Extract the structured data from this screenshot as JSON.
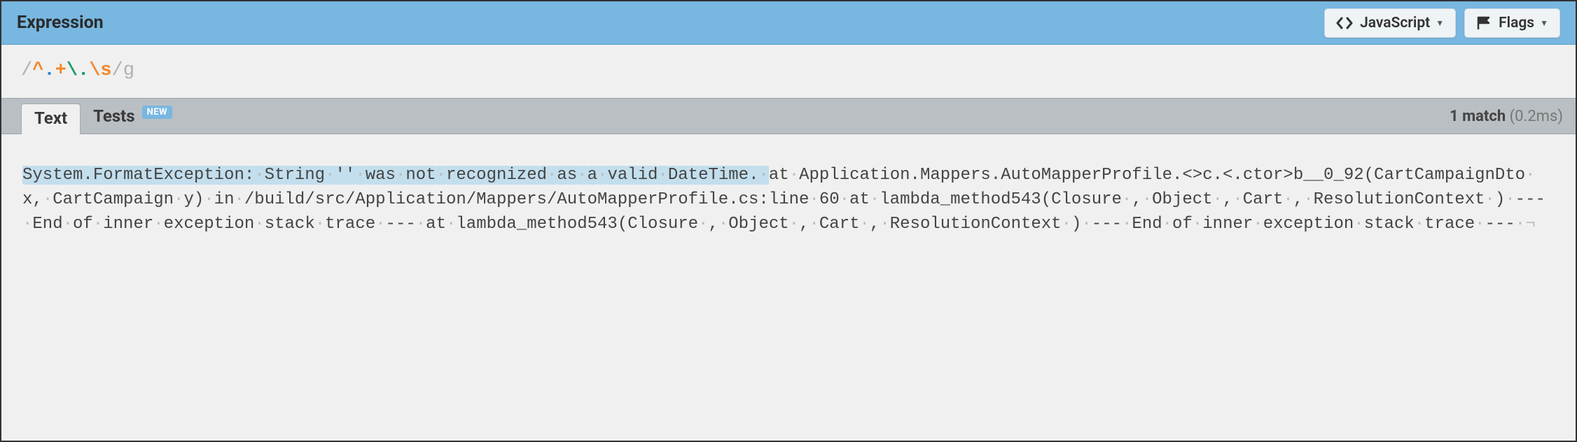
{
  "header": {
    "title": "Expression",
    "buttons": {
      "javascript": "JavaScript",
      "flags": "Flags"
    }
  },
  "expression": {
    "open_delim": "/",
    "anchor": "^",
    "any": ".",
    "plus": "+",
    "escape_dot_bs": "\\",
    "escape_dot_dot": ".",
    "escape_s_bs": "\\",
    "escape_s_s": "s",
    "close_delim": "/",
    "flags": "g"
  },
  "tabs": {
    "text": "Text",
    "tests": "Tests",
    "tests_badge": "NEW"
  },
  "match_info": {
    "count_label": "1 match",
    "time_label": "(0.2ms)"
  },
  "test_text": {
    "words": [
      {
        "t": "System.FormatException:",
        "hl": true
      },
      {
        "t": "String",
        "hl": true
      },
      {
        "t": "''",
        "hl": true
      },
      {
        "t": "was",
        "hl": true
      },
      {
        "t": "not",
        "hl": true
      },
      {
        "t": "recognized",
        "hl": true
      },
      {
        "t": "as",
        "hl": true
      },
      {
        "t": "a",
        "hl": true
      },
      {
        "t": "valid",
        "hl": true
      },
      {
        "t": "DateTime.",
        "hl": true
      },
      {
        "t": "at",
        "hl": false
      },
      {
        "t": "Application.Mappers.AutoMapperProfile.<>c.<.ctor>b__0_92(CartCampaignDto",
        "hl": false
      },
      {
        "t": "x,",
        "hl": false
      },
      {
        "t": "CartCampaign",
        "hl": false
      },
      {
        "t": "y)",
        "hl": false
      },
      {
        "t": "in",
        "hl": false
      },
      {
        "t": "/build/src/Application/Mappers/AutoMapperProfile.cs:line",
        "hl": false
      },
      {
        "t": "60",
        "hl": false
      },
      {
        "t": "at",
        "hl": false
      },
      {
        "t": "lambda_method543(Closure",
        "hl": false
      },
      {
        "t": ",",
        "hl": false
      },
      {
        "t": "Object",
        "hl": false
      },
      {
        "t": ",",
        "hl": false
      },
      {
        "t": "Cart",
        "hl": false
      },
      {
        "t": ",",
        "hl": false
      },
      {
        "t": "ResolutionContext",
        "hl": false
      },
      {
        "t": ")",
        "hl": false
      },
      {
        "t": "---",
        "hl": false
      },
      {
        "t": "End",
        "hl": false
      },
      {
        "t": "of",
        "hl": false
      },
      {
        "t": "inner",
        "hl": false
      },
      {
        "t": "exception",
        "hl": false
      },
      {
        "t": "stack",
        "hl": false
      },
      {
        "t": "trace",
        "hl": false
      },
      {
        "t": "---",
        "hl": false
      },
      {
        "t": "at",
        "hl": false
      },
      {
        "t": "lambda_method543(Closure",
        "hl": false
      },
      {
        "t": ",",
        "hl": false
      },
      {
        "t": "Object",
        "hl": false
      },
      {
        "t": ",",
        "hl": false
      },
      {
        "t": "Cart",
        "hl": false
      },
      {
        "t": ",",
        "hl": false
      },
      {
        "t": "ResolutionContext",
        "hl": false
      },
      {
        "t": ")",
        "hl": false
      },
      {
        "t": "---",
        "hl": false
      },
      {
        "t": "End",
        "hl": false
      },
      {
        "t": "of",
        "hl": false
      },
      {
        "t": "inner",
        "hl": false
      },
      {
        "t": "exception",
        "hl": false
      },
      {
        "t": "stack",
        "hl": false
      },
      {
        "t": "trace",
        "hl": false
      },
      {
        "t": "---",
        "hl": false
      }
    ]
  }
}
